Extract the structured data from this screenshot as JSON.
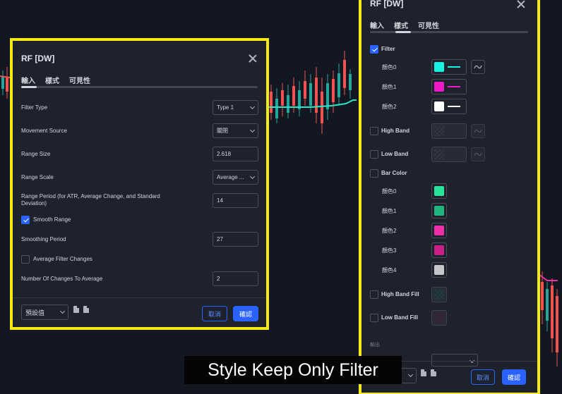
{
  "colors": {
    "background": "#131722",
    "dialog": "#1e222d",
    "highlight": "#f5ea14",
    "accent": "#2962ff",
    "filter_line": "#26e8c4",
    "candle_up": "#26a69a",
    "candle_down": "#ef5350"
  },
  "dialog_left": {
    "title": "RF [DW]",
    "tabs": [
      "輸入",
      "樣式",
      "可見性"
    ],
    "fields": {
      "filter_type": {
        "label": "Filter Type",
        "value": "Type 1"
      },
      "movement_source": {
        "label": "Movement Source",
        "value": "關閉"
      },
      "range_size": {
        "label": "Range Size",
        "value": "2.618"
      },
      "range_scale": {
        "label": "Range Scale",
        "value": "Average ..."
      },
      "range_period": {
        "label": "Range Period (for ATR, Average Change, and Standard Deviation)",
        "value": "14"
      },
      "smooth_range": {
        "label": "Smooth Range",
        "checked": true
      },
      "smoothing_period": {
        "label": "Smoothing Period",
        "value": "27"
      },
      "average_filter_changes": {
        "label": "Average Filter Changes",
        "checked": false
      },
      "number_of_changes": {
        "label": "Number Of Changes To Average",
        "value": "2"
      }
    },
    "footer": {
      "preset": "預設值",
      "cancel": "取消",
      "ok": "確認"
    }
  },
  "dialog_right": {
    "title": "RF [DW]",
    "tabs": [
      "輸入",
      "樣式",
      "可見性"
    ],
    "filter": {
      "label": "Filter",
      "checked": true
    },
    "filter_colors": [
      {
        "label": "顏色0",
        "color": "#18f0e2"
      },
      {
        "label": "顏色1",
        "color": "#f018c8"
      },
      {
        "label": "顏色2",
        "color": "#ffffff"
      }
    ],
    "high_band": {
      "label": "High Band",
      "checked": false
    },
    "low_band": {
      "label": "Low Band",
      "checked": false
    },
    "bar_color": {
      "label": "Bar Color",
      "checked": false
    },
    "bar_colors": [
      {
        "label": "顏色0",
        "color": "#29e39a"
      },
      {
        "label": "顏色1",
        "color": "#1fb57e"
      },
      {
        "label": "顏色2",
        "color": "#ef2fa7"
      },
      {
        "label": "顏色3",
        "color": "#c91f86"
      },
      {
        "label": "顏色4",
        "color": "#c4c6cc"
      }
    ],
    "high_band_fill": {
      "label": "High Band Fill",
      "checked": false
    },
    "low_band_fill": {
      "label": "Low Band Fill",
      "checked": false
    },
    "output_section": "輸出",
    "footer": {
      "cancel": "取消",
      "ok": "確認"
    }
  },
  "subtitle": "Style Keep Only Filter"
}
